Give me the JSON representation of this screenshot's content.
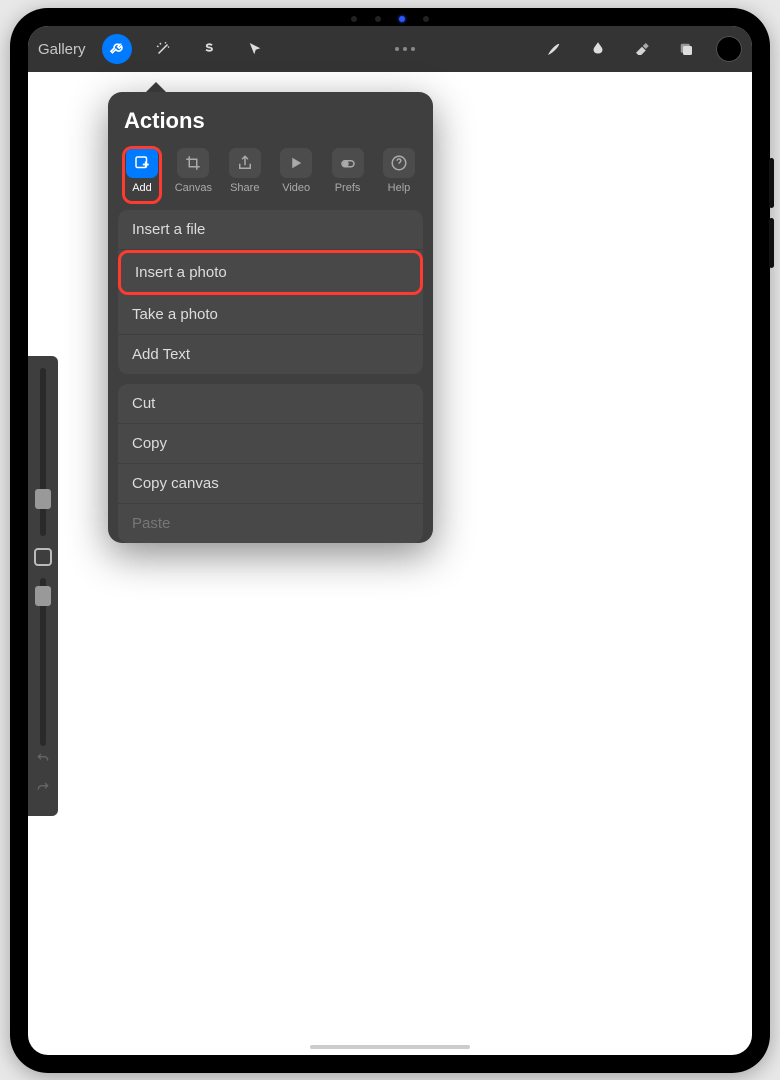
{
  "toolbar": {
    "gallery_label": "Gallery"
  },
  "popover": {
    "title": "Actions",
    "tabs": [
      {
        "label": "Add"
      },
      {
        "label": "Canvas"
      },
      {
        "label": "Share"
      },
      {
        "label": "Video"
      },
      {
        "label": "Prefs"
      },
      {
        "label": "Help"
      }
    ],
    "section1": [
      "Insert a file",
      "Insert a photo",
      "Take a photo",
      "Add Text"
    ],
    "section2": [
      "Cut",
      "Copy",
      "Copy canvas",
      "Paste"
    ]
  }
}
